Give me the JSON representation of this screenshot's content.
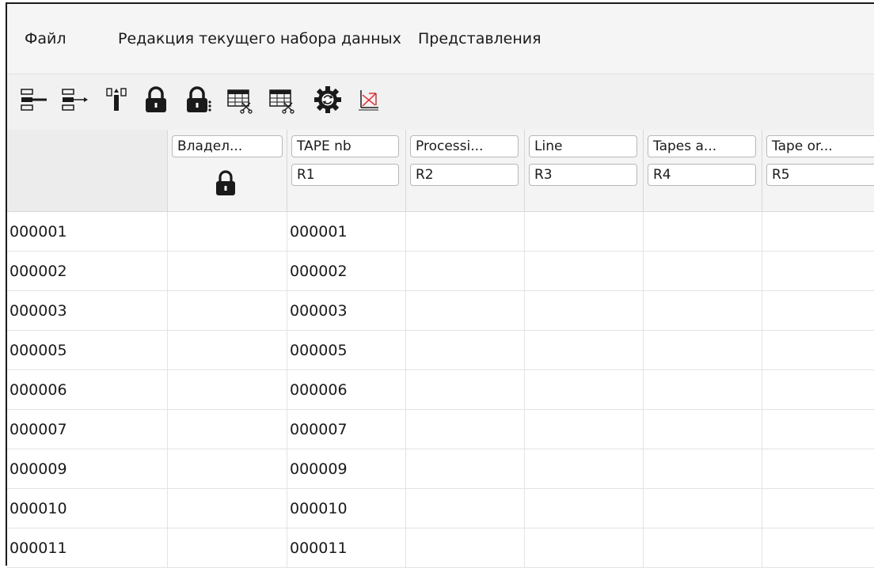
{
  "menubar": {
    "items": [
      "Файл",
      "Редакция текущего набора данных",
      "Представления"
    ]
  },
  "toolbar": {
    "buttons": [
      {
        "icon": "insert-row-left-icon"
      },
      {
        "icon": "insert-row-right-icon"
      },
      {
        "icon": "column-split-icon"
      },
      {
        "icon": "lock-icon"
      },
      {
        "icon": "lock-multiple-icon"
      },
      {
        "icon": "table-cut-icon"
      },
      {
        "icon": "table-cut-alt-icon"
      },
      {
        "icon": "gear-refresh-icon"
      },
      {
        "icon": "chart-icon"
      }
    ]
  },
  "grid": {
    "columns": [
      {
        "name": "Владел...",
        "code": "",
        "locked": true
      },
      {
        "name": "TAPE nb",
        "code": "R1"
      },
      {
        "name": "Processi...",
        "code": "R2"
      },
      {
        "name": "Line",
        "code": "R3"
      },
      {
        "name": "Tapes a...",
        "code": "R4"
      },
      {
        "name": "Tape or...",
        "code": "R5"
      }
    ],
    "rows": [
      {
        "id": "000001",
        "cells": [
          "",
          "000001",
          "",
          "",
          "",
          ""
        ]
      },
      {
        "id": "000002",
        "cells": [
          "",
          "000002",
          "",
          "",
          "",
          ""
        ]
      },
      {
        "id": "000003",
        "cells": [
          "",
          "000003",
          "",
          "",
          "",
          ""
        ]
      },
      {
        "id": "000005",
        "cells": [
          "",
          "000005",
          "",
          "",
          "",
          ""
        ]
      },
      {
        "id": "000006",
        "cells": [
          "",
          "000006",
          "",
          "",
          "",
          ""
        ]
      },
      {
        "id": "000007",
        "cells": [
          "",
          "000007",
          "",
          "",
          "",
          ""
        ]
      },
      {
        "id": "000009",
        "cells": [
          "",
          "000009",
          "",
          "",
          "",
          ""
        ]
      },
      {
        "id": "000010",
        "cells": [
          "",
          "000010",
          "",
          "",
          "",
          ""
        ]
      },
      {
        "id": "000011",
        "cells": [
          "",
          "000011",
          "",
          "",
          "",
          ""
        ]
      }
    ]
  },
  "colors": {
    "lock": "#1a1a1a",
    "chart_accent": "#d9242b"
  }
}
